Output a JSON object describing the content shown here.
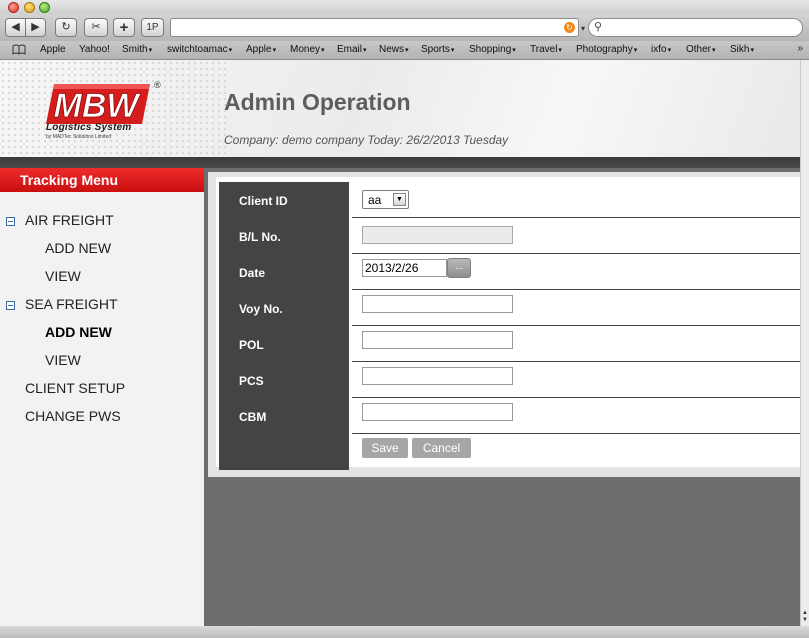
{
  "browser": {
    "toolbar": {
      "back_icon": "◀",
      "forward_icon": "▶",
      "reload_icon": "↻",
      "snip_icon": "✂",
      "add_icon": "+",
      "onepassword_label": "1P",
      "url_value": "",
      "search_value": ""
    },
    "bookmarks": [
      {
        "label": "Apple",
        "menu": false
      },
      {
        "label": "Yahoo!",
        "menu": false
      },
      {
        "label": "Smith",
        "menu": true
      },
      {
        "label": "switchtoamac",
        "menu": true
      },
      {
        "label": "Apple",
        "menu": true
      },
      {
        "label": "Money",
        "menu": true
      },
      {
        "label": "Email",
        "menu": true
      },
      {
        "label": "News",
        "menu": true
      },
      {
        "label": "Sports",
        "menu": true
      },
      {
        "label": "Shopping",
        "menu": true
      },
      {
        "label": "Travel",
        "menu": true
      },
      {
        "label": "Photography",
        "menu": true
      },
      {
        "label": "ixfo",
        "menu": true
      },
      {
        "label": "Other",
        "menu": true
      },
      {
        "label": "Sikh",
        "menu": true
      }
    ],
    "bookmarks_more": "»"
  },
  "header": {
    "logo_text": "MBW",
    "logo_subtitle": "Logistics System",
    "logo_tiny": "by MADTec Solutions Limited",
    "logo_registered": "®",
    "title": "Admin Operation",
    "company_line": "Company: demo company Today: 26/2/2013 Tuesday"
  },
  "sidebar": {
    "title": "Tracking Menu",
    "items": [
      {
        "label": "AIR FREIGHT",
        "level": "top",
        "collapsible": true
      },
      {
        "label": "ADD NEW",
        "level": "sub",
        "active": false
      },
      {
        "label": "VIEW",
        "level": "sub",
        "active": false
      },
      {
        "label": "SEA FREIGHT",
        "level": "top",
        "collapsible": true
      },
      {
        "label": "ADD NEW",
        "level": "sub",
        "active": true
      },
      {
        "label": "VIEW",
        "level": "sub",
        "active": false
      },
      {
        "label": "CLIENT SETUP",
        "level": "top",
        "collapsible": false
      },
      {
        "label": "CHANGE PWS",
        "level": "top",
        "collapsible": false
      }
    ]
  },
  "form": {
    "fields": [
      {
        "label": "Client ID",
        "type": "select",
        "value": "aa"
      },
      {
        "label": "B/L No.",
        "type": "text",
        "value": "",
        "disabled": true
      },
      {
        "label": "Date",
        "type": "date",
        "value": "2013/2/26",
        "picker_label": "..."
      },
      {
        "label": "Voy No.",
        "type": "text",
        "value": ""
      },
      {
        "label": "POL",
        "type": "text",
        "value": ""
      },
      {
        "label": "PCS",
        "type": "text",
        "value": ""
      },
      {
        "label": "CBM",
        "type": "text",
        "value": ""
      }
    ],
    "save_label": "Save",
    "cancel_label": "Cancel"
  },
  "colors": {
    "menu_red": "#d81b1b",
    "label_column": "#444444",
    "button_gray": "#a6a6a6",
    "title_gray": "#5d5d5d"
  }
}
